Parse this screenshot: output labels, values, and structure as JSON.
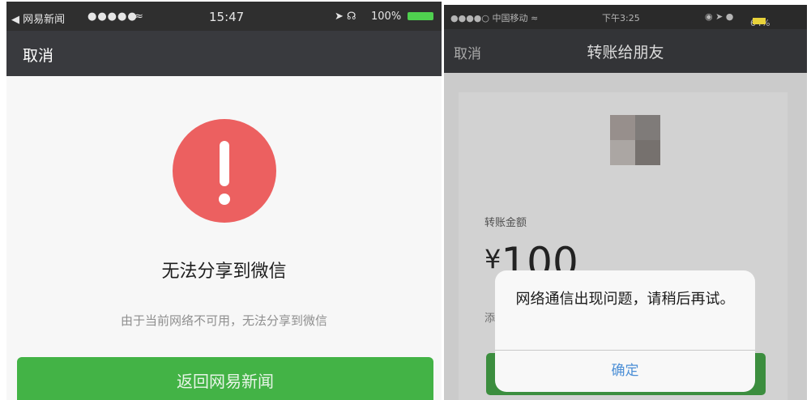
{
  "left": {
    "status_bar": {
      "back_app": "◀ 网易新闻",
      "signal": "●●●●●",
      "wifi": "≈",
      "time": "15:47",
      "battery": "100%"
    },
    "nav": {
      "cancel_label": "取消"
    },
    "alert": {
      "title": "无法分享到微信",
      "description": "由于当前网络不可用，无法分享到微信",
      "icon": "exclamation-icon",
      "icon_color": "#ec6060"
    },
    "back_button_label": "返回网易新闻",
    "accent_color": "#43b346"
  },
  "right": {
    "status_bar": {
      "carrier": "●●●●○ 中国移动 ≈",
      "time": "下午3:25",
      "battery": "64%"
    },
    "nav": {
      "cancel_label": "取消",
      "title": "转账给朋友"
    },
    "transfer": {
      "amount_label": "转账金额",
      "currency": "¥",
      "amount": "100",
      "side_char": "添"
    },
    "dialog": {
      "message": "网络通信出现问题，请稍后再试。",
      "ok_label": "确定"
    }
  }
}
